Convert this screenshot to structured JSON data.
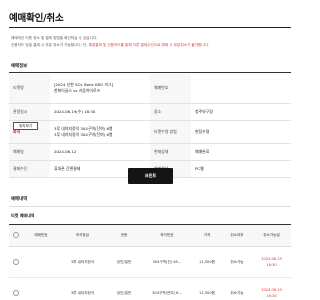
{
  "page": {
    "title": "예매확인/취소"
  },
  "notices": {
    "line1": "예매하신 티켓 취소 및 결제 방법을 확인하실 수 있습니다.",
    "line2_prefix": "신용카드 당일 결제 시 부분 취소가 가능합니다. 단,",
    "line2_warning": "특정결제 및 신용카드를 통해 다른 결제수단으로 예매 시 부분취소가 불가합니다."
  },
  "booking_info": {
    "section_title": "예매정보",
    "ticket_label": "티켓명",
    "ticket_line1": "[2024 신한 SOL Bank KBO 리그]",
    "ticket_line2": "한화이글스 vs 키움히어로즈",
    "booking_no_label": "예매번호",
    "booking_no_value": "",
    "show_date_label": "관람일시",
    "show_date_value": "2024.06.19(수) 18:30",
    "venue_label": "장소",
    "venue_value": "청주야구장",
    "seat_label": "좌석",
    "seat_line1": "3루 내야지정석 304구역(잔여) 6열",
    "seat_line2": "3루 내야지정석 304구역(잔여) 6열",
    "receive_label": "티켓수령 방법",
    "receive_value": "현장수령",
    "booked_date_label": "예매일",
    "booked_date_value": "2024.06.12",
    "status_label": "현재상태",
    "status_value": "예매완료",
    "payment_label": "결제수단",
    "payment_value": "휴대폰 간편결제",
    "channel_label": "예매채널",
    "channel_value": "PC웹",
    "tooltip": "위치보기"
  },
  "actions": {
    "print_label": "프린트"
  },
  "details": {
    "section_title": "예매내역",
    "subsection_title": "티켓 예매내역",
    "columns": [
      "예매번호",
      "좌석등급",
      "권종",
      "좌석번호",
      "가격",
      "취소여부",
      "취소가능일"
    ],
    "rows": [
      {
        "seat_grade": "3루 내야지정석",
        "ticket_type": "성인/일반",
        "seat_no": "304구역(잔) 65...",
        "price": "11,500원",
        "cancel": "취소가능",
        "cancel_date": "2024.06.19",
        "cancel_time": "16:30"
      },
      {
        "seat_grade": "3루 내야지정석",
        "ticket_type": "성인/일반",
        "seat_no": "304구역(잔여) 6...",
        "price": "11,500원",
        "cancel": "취소가능",
        "cancel_date": "2024.06.19",
        "cancel_time": "16:30"
      }
    ]
  },
  "colors": {
    "warning": "#d8323c",
    "button": "#141414"
  }
}
